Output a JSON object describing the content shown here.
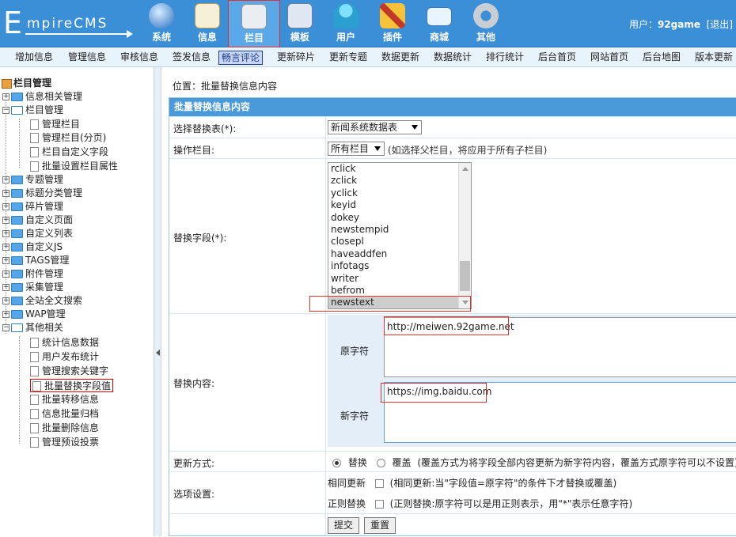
{
  "header": {
    "logo_big": "E",
    "logo_small": "mpireCMS",
    "nav": [
      {
        "label": "系统",
        "icon": "globe-icon"
      },
      {
        "label": "信息",
        "icon": "notepad-icon"
      },
      {
        "label": "栏目",
        "icon": "folder-icon"
      },
      {
        "label": "模板",
        "icon": "window-template-icon"
      },
      {
        "label": "用户",
        "icon": "user-icon"
      },
      {
        "label": "插件",
        "icon": "tools-icon"
      },
      {
        "label": "商城",
        "icon": "card-icon"
      },
      {
        "label": "其他",
        "icon": "gear-icon"
      }
    ],
    "user_label": "用户：",
    "username": "92game",
    "logout": "[退出]"
  },
  "submenu": [
    "增加信息",
    "管理信息",
    "审核信息",
    "签发信息",
    "畅言评论",
    "更新碎片",
    "更新专题",
    "数据更新",
    "数据统计",
    "排行统计",
    "后台首页",
    "网站首页",
    "后台地图",
    "版本更新"
  ],
  "sidebar": {
    "root": "栏目管理",
    "items": [
      {
        "label": "信息相关管理"
      },
      {
        "label": "栏目管理"
      },
      {
        "label": "管理栏目"
      },
      {
        "label": "管理栏目(分页)"
      },
      {
        "label": "栏目自定义字段"
      },
      {
        "label": "批量设置栏目属性"
      },
      {
        "label": "专题管理"
      },
      {
        "label": "标题分类管理"
      },
      {
        "label": "碎片管理"
      },
      {
        "label": "自定义页面"
      },
      {
        "label": "自定义列表"
      },
      {
        "label": "自定义JS"
      },
      {
        "label": "TAGS管理"
      },
      {
        "label": "附件管理"
      },
      {
        "label": "采集管理"
      },
      {
        "label": "全站全文搜索"
      },
      {
        "label": "WAP管理"
      },
      {
        "label": "其他相关"
      },
      {
        "label": "统计信息数据"
      },
      {
        "label": "用户发布统计"
      },
      {
        "label": "管理搜索关键字"
      },
      {
        "label": "批量替换字段值"
      },
      {
        "label": "批量转移信息"
      },
      {
        "label": "信息批量归档"
      },
      {
        "label": "批量删除信息"
      },
      {
        "label": "管理预设投票"
      }
    ]
  },
  "breadcrumb": "位置：批量替换信息内容",
  "form": {
    "title": "批量替换信息内容",
    "table_label": "选择替换表(*):",
    "table_value": "新闻系统数据表",
    "column_label": "操作栏目:",
    "column_value": "所有栏目",
    "column_hint": "(如选择父栏目，将应用于所有子栏目)",
    "field_label": "替换字段(*):",
    "fields": [
      "rclick",
      "zclick",
      "yclick",
      "keyid",
      "dokey",
      "newstempid",
      "closepl",
      "haveaddfen",
      "infotags",
      "writer",
      "befrom",
      "newstext"
    ],
    "content_label": "替换内容:",
    "old_label": "原字符",
    "old_value": "http://meiwen.92game.net",
    "new_label": "新字符",
    "new_value": "https://img.baidu.com",
    "mode_label": "更新方式:",
    "mode_replace": "替换",
    "mode_cover": "覆盖",
    "mode_hint": "(覆盖方式为将字段全部内容更新为新字符内容，覆盖方式原字符可以不设置)",
    "options_label": "选项设置:",
    "opt_same": "相同更新",
    "opt_same_hint": "(相同更新:当\"字段值=原字符\"的条件下才替换或覆盖)",
    "opt_regex": "正则替换",
    "opt_regex_hint": "(正则替换:原字符可以是用正则表示，用\"*\"表示任意字符)",
    "submit": "提交",
    "reset": "重置"
  }
}
